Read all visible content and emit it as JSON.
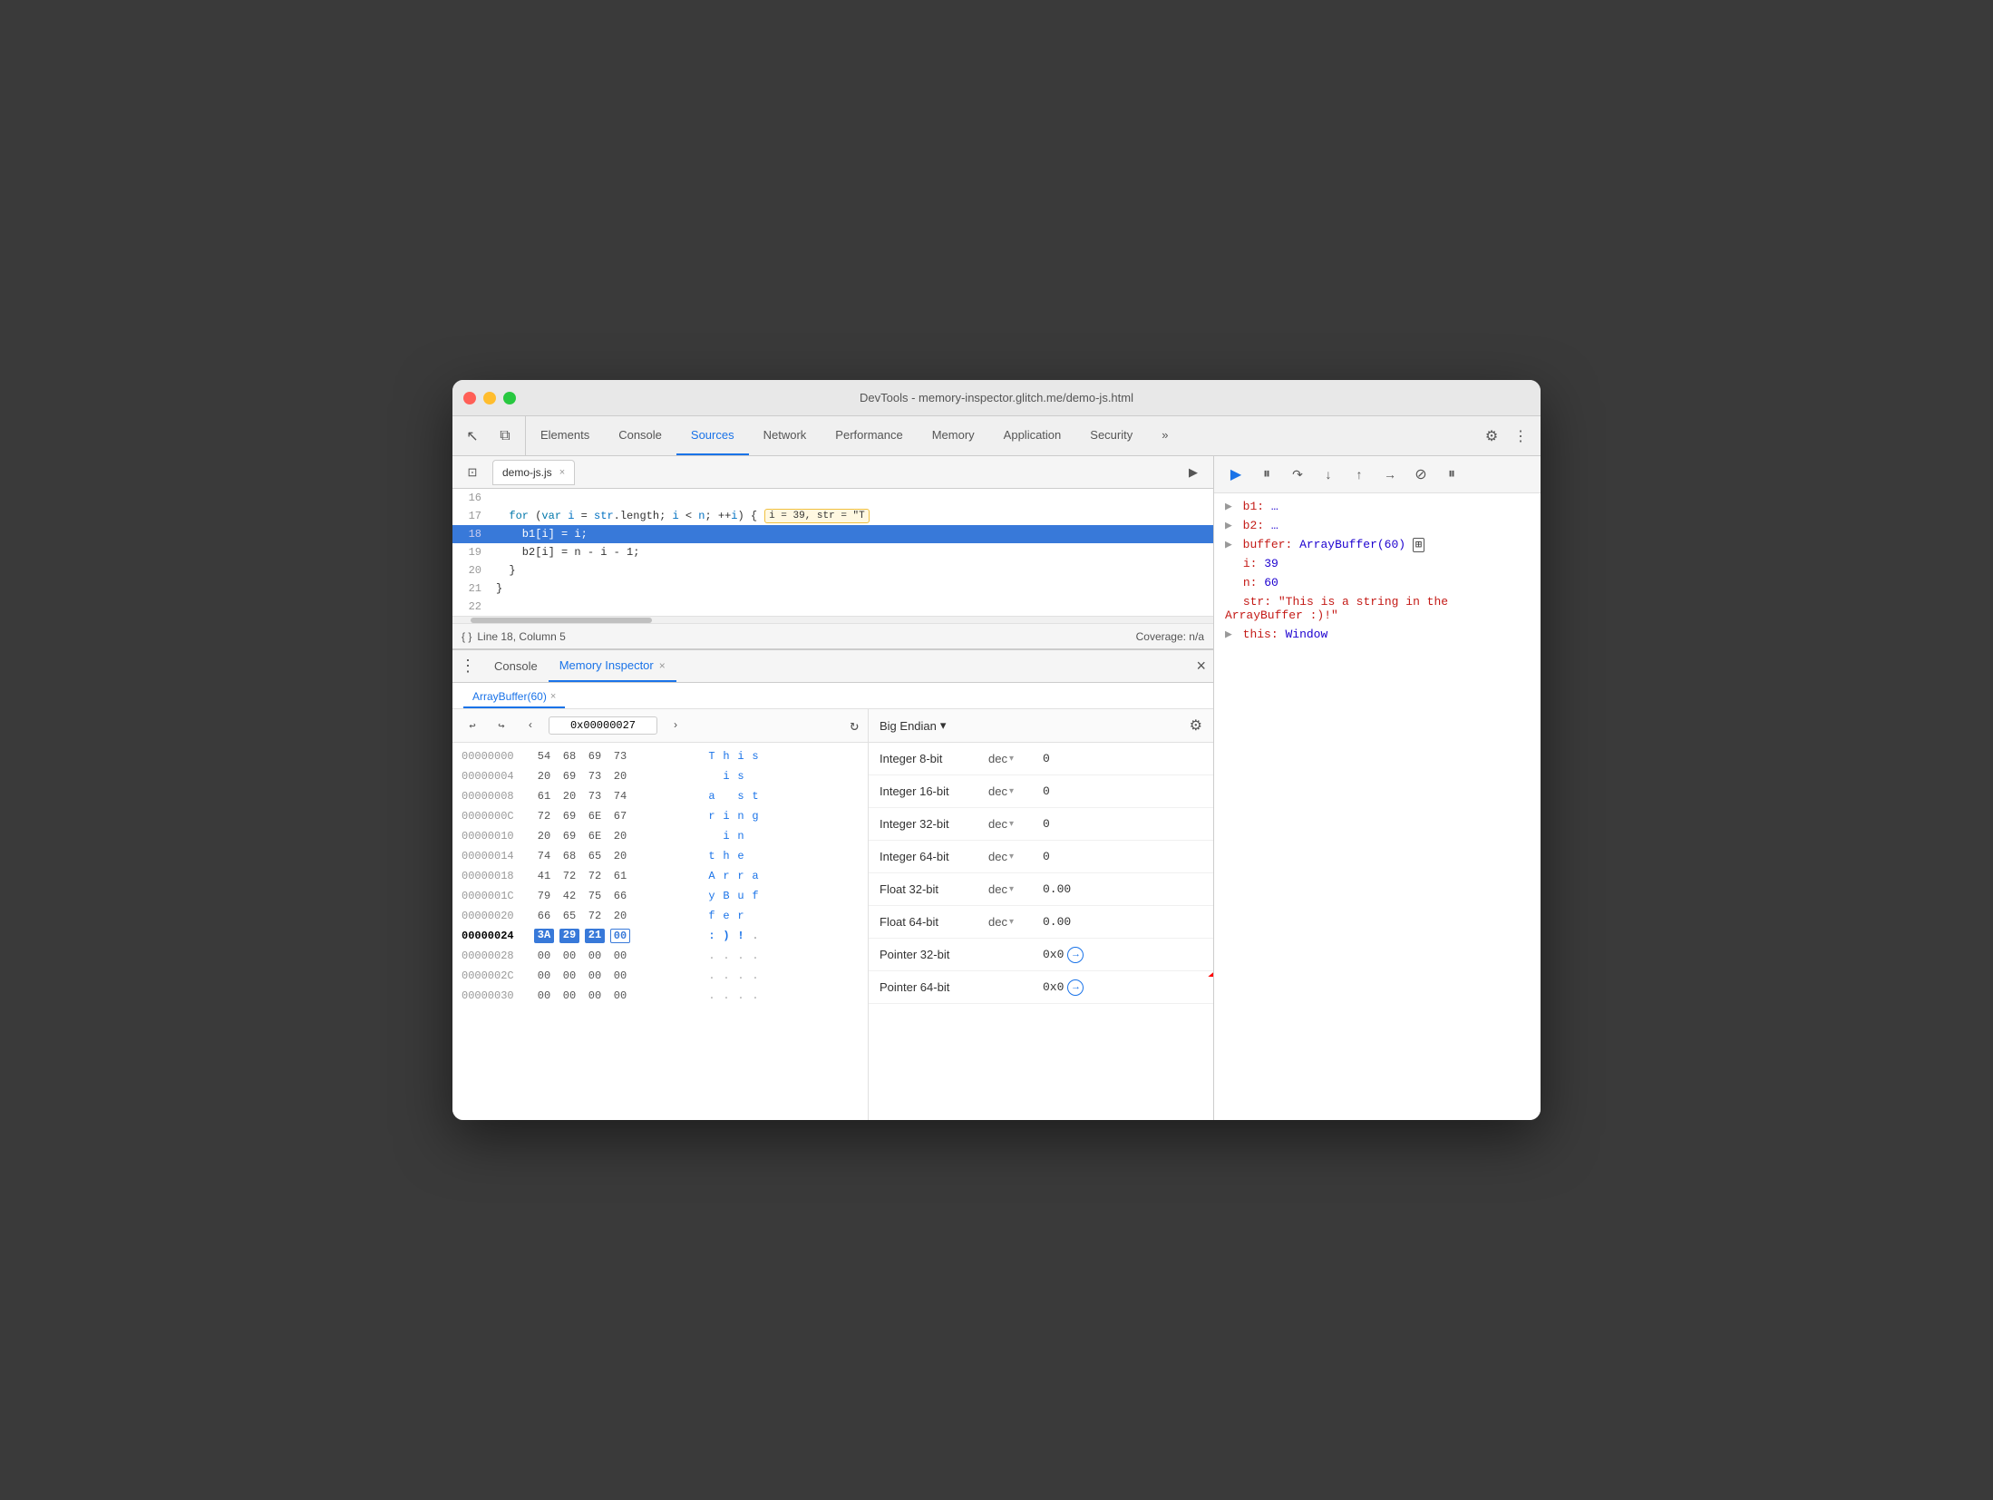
{
  "window": {
    "title": "DevTools - memory-inspector.glitch.me/demo-js.html"
  },
  "tabs": {
    "items": [
      "Elements",
      "Console",
      "Sources",
      "Network",
      "Performance",
      "Memory",
      "Application",
      "Security"
    ],
    "active": "Sources",
    "more_label": "»"
  },
  "toolbar": {
    "settings_icon": "⚙",
    "more_icon": "⋮",
    "cursor_icon": "↖",
    "layers_icon": "⧉"
  },
  "debug_toolbar": {
    "play_icon": "▶",
    "pause_icon": "⏸",
    "step_over_icon": "↷",
    "step_into_icon": "↓",
    "step_out_icon": "↑",
    "step_icon": "→",
    "breakpoints_icon": "⊘",
    "pause_exceptions_icon": "⏸"
  },
  "file_tab": {
    "name": "demo-js.js",
    "close": "×"
  },
  "code": {
    "lines": [
      {
        "num": "16",
        "content": "",
        "highlight": false
      },
      {
        "num": "17",
        "content": "  for (var i = str.length; i < n; ++i) {  ",
        "tooltip": "i = 39, str = \"T",
        "highlight": false
      },
      {
        "num": "18",
        "content": "    b1[i] = i;",
        "highlight": true
      },
      {
        "num": "19",
        "content": "    b2[i] = n - i - 1;",
        "highlight": false
      },
      {
        "num": "20",
        "content": "  }",
        "highlight": false
      },
      {
        "num": "21",
        "content": "}",
        "highlight": false
      },
      {
        "num": "22",
        "content": "",
        "highlight": false
      }
    ]
  },
  "status_bar": {
    "position": "Line 18, Column 5",
    "coverage": "Coverage: n/a"
  },
  "bottom_tabs": {
    "items": [
      "Console",
      "Memory Inspector"
    ],
    "active": "Memory Inspector",
    "close": "×"
  },
  "array_buffer_tab": {
    "name": "ArrayBuffer(60)",
    "close": "×"
  },
  "hex_toolbar": {
    "back_icon": "←",
    "forward_icon": "→",
    "prev_icon": "‹",
    "next_icon": "›",
    "address": "0x00000027",
    "refresh_icon": "↻"
  },
  "hex_rows": [
    {
      "offset": "00000000",
      "bytes": [
        "54",
        "68",
        "69",
        "73"
      ],
      "chars": [
        "T",
        "h",
        "i",
        "s"
      ],
      "char_types": [
        "blue",
        "blue",
        "blue",
        "blue"
      ],
      "highlight": false
    },
    {
      "offset": "00000004",
      "bytes": [
        "20",
        "69",
        "73",
        "20"
      ],
      "chars": [
        " ",
        "i",
        "s",
        " "
      ],
      "char_types": [
        "dot",
        "blue",
        "blue",
        "dot"
      ],
      "highlight": false
    },
    {
      "offset": "00000008",
      "bytes": [
        "61",
        "20",
        "73",
        "74"
      ],
      "chars": [
        "a",
        " ",
        "s",
        "t"
      ],
      "char_types": [
        "blue",
        "dot",
        "blue",
        "blue"
      ],
      "highlight": false
    },
    {
      "offset": "0000000C",
      "bytes": [
        "72",
        "69",
        "6E",
        "67"
      ],
      "chars": [
        "r",
        "i",
        "n",
        "g"
      ],
      "char_types": [
        "blue",
        "blue",
        "blue",
        "blue"
      ],
      "highlight": false
    },
    {
      "offset": "00000010",
      "bytes": [
        "20",
        "69",
        "6E",
        "20"
      ],
      "chars": [
        " ",
        "i",
        "n",
        " "
      ],
      "char_types": [
        "dot",
        "blue",
        "blue",
        "dot"
      ],
      "highlight": false
    },
    {
      "offset": "00000014",
      "bytes": [
        "74",
        "68",
        "65",
        "20"
      ],
      "chars": [
        "t",
        "h",
        "e",
        " "
      ],
      "char_types": [
        "blue",
        "blue",
        "blue",
        "dot"
      ],
      "highlight": false
    },
    {
      "offset": "00000018",
      "bytes": [
        "41",
        "72",
        "72",
        "61"
      ],
      "chars": [
        "A",
        "r",
        "r",
        "a"
      ],
      "char_types": [
        "blue",
        "blue",
        "blue",
        "blue"
      ],
      "highlight": false
    },
    {
      "offset": "0000001C",
      "bytes": [
        "79",
        "42",
        "75",
        "66"
      ],
      "chars": [
        "y",
        "B",
        "u",
        "f"
      ],
      "char_types": [
        "blue",
        "blue",
        "blue",
        "blue"
      ],
      "highlight": false
    },
    {
      "offset": "00000020",
      "bytes": [
        "66",
        "65",
        "72",
        "20"
      ],
      "chars": [
        "f",
        "e",
        "r",
        " "
      ],
      "char_types": [
        "blue",
        "blue",
        "blue",
        "dot"
      ],
      "highlight": false
    },
    {
      "offset": "00000024",
      "bytes": [
        "3A",
        "29",
        "21",
        "00"
      ],
      "chars": [
        ":",
        ")",
        "!",
        "."
      ],
      "char_types": [
        "blue",
        "blue",
        "blue",
        "dot"
      ],
      "highlight": true,
      "selected_byte": 3
    },
    {
      "offset": "00000028",
      "bytes": [
        "00",
        "00",
        "00",
        "00"
      ],
      "chars": [
        ".",
        ".",
        ".",
        "."
      ],
      "char_types": [
        "dot",
        "dot",
        "dot",
        "dot"
      ],
      "highlight": false
    },
    {
      "offset": "0000002C",
      "bytes": [
        "00",
        "00",
        "00",
        "00"
      ],
      "chars": [
        ".",
        ".",
        ".",
        "."
      ],
      "char_types": [
        "dot",
        "dot",
        "dot",
        "dot"
      ],
      "highlight": false
    },
    {
      "offset": "00000030",
      "bytes": [
        "00",
        "00",
        "00",
        "00"
      ],
      "chars": [
        ".",
        ".",
        ".",
        "."
      ],
      "char_types": [
        "dot",
        "dot",
        "dot",
        "dot"
      ],
      "highlight": false
    }
  ],
  "data_inspector": {
    "endian": "Big Endian",
    "rows": [
      {
        "label": "Integer 8-bit",
        "format": "dec",
        "value": "0",
        "type": "plain"
      },
      {
        "label": "Integer 16-bit",
        "format": "dec",
        "value": "0",
        "type": "plain"
      },
      {
        "label": "Integer 32-bit",
        "format": "dec",
        "value": "0",
        "type": "plain"
      },
      {
        "label": "Integer 64-bit",
        "format": "dec",
        "value": "0",
        "type": "plain"
      },
      {
        "label": "Float 32-bit",
        "format": "dec",
        "value": "0.00",
        "type": "plain"
      },
      {
        "label": "Float 64-bit",
        "format": "dec",
        "value": "0.00",
        "type": "plain"
      },
      {
        "label": "Pointer 32-bit",
        "format": "",
        "value": "0x0",
        "type": "link"
      },
      {
        "label": "Pointer 64-bit",
        "format": "",
        "value": "0x0",
        "type": "link"
      }
    ]
  },
  "scope": {
    "items": [
      {
        "key": "b1:",
        "val": "…",
        "type": "expandable"
      },
      {
        "key": "b2:",
        "val": "…",
        "type": "expandable"
      },
      {
        "key": "buffer:",
        "val": "ArrayBuffer(60) 🔲",
        "type": "expandable"
      },
      {
        "key": "i:",
        "val": "39",
        "type": "value"
      },
      {
        "key": "n:",
        "val": "60",
        "type": "value"
      },
      {
        "key": "str:",
        "val": "\"This is a string in the ArrayBuffer :)!\"",
        "type": "string"
      },
      {
        "key": "this:",
        "val": "Window",
        "type": "expandable"
      }
    ]
  }
}
